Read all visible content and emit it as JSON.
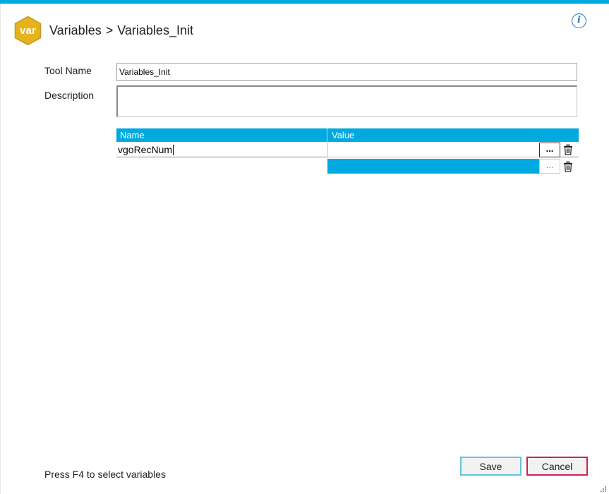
{
  "header": {
    "logo_text": "var",
    "breadcrumb_parent": "Variables",
    "breadcrumb_separator": ">",
    "breadcrumb_current": "Variables_Init"
  },
  "info_icon": "i",
  "form": {
    "tool_name_label": "Tool Name",
    "tool_name_value": "Variables_Init",
    "description_label": "Description",
    "description_value": ""
  },
  "grid": {
    "columns": [
      "Name",
      "Value"
    ],
    "rows": [
      {
        "name": "vgoRecNum",
        "value": "",
        "ellipsis": "...",
        "selected": false
      },
      {
        "name": "",
        "value": "",
        "ellipsis": "...",
        "selected": true
      }
    ]
  },
  "footer": {
    "hint": "Press F4 to select variables",
    "save_label": "Save",
    "cancel_label": "Cancel"
  },
  "colors": {
    "accent": "#00a9e0",
    "save_border": "#63c3e2",
    "cancel_border": "#c8254e",
    "logo_fill": "#e6b31e"
  },
  "icons": [
    "var-logo-icon",
    "info-icon",
    "trash-icon",
    "ellipsis-icon",
    "resize-grip-icon"
  ]
}
